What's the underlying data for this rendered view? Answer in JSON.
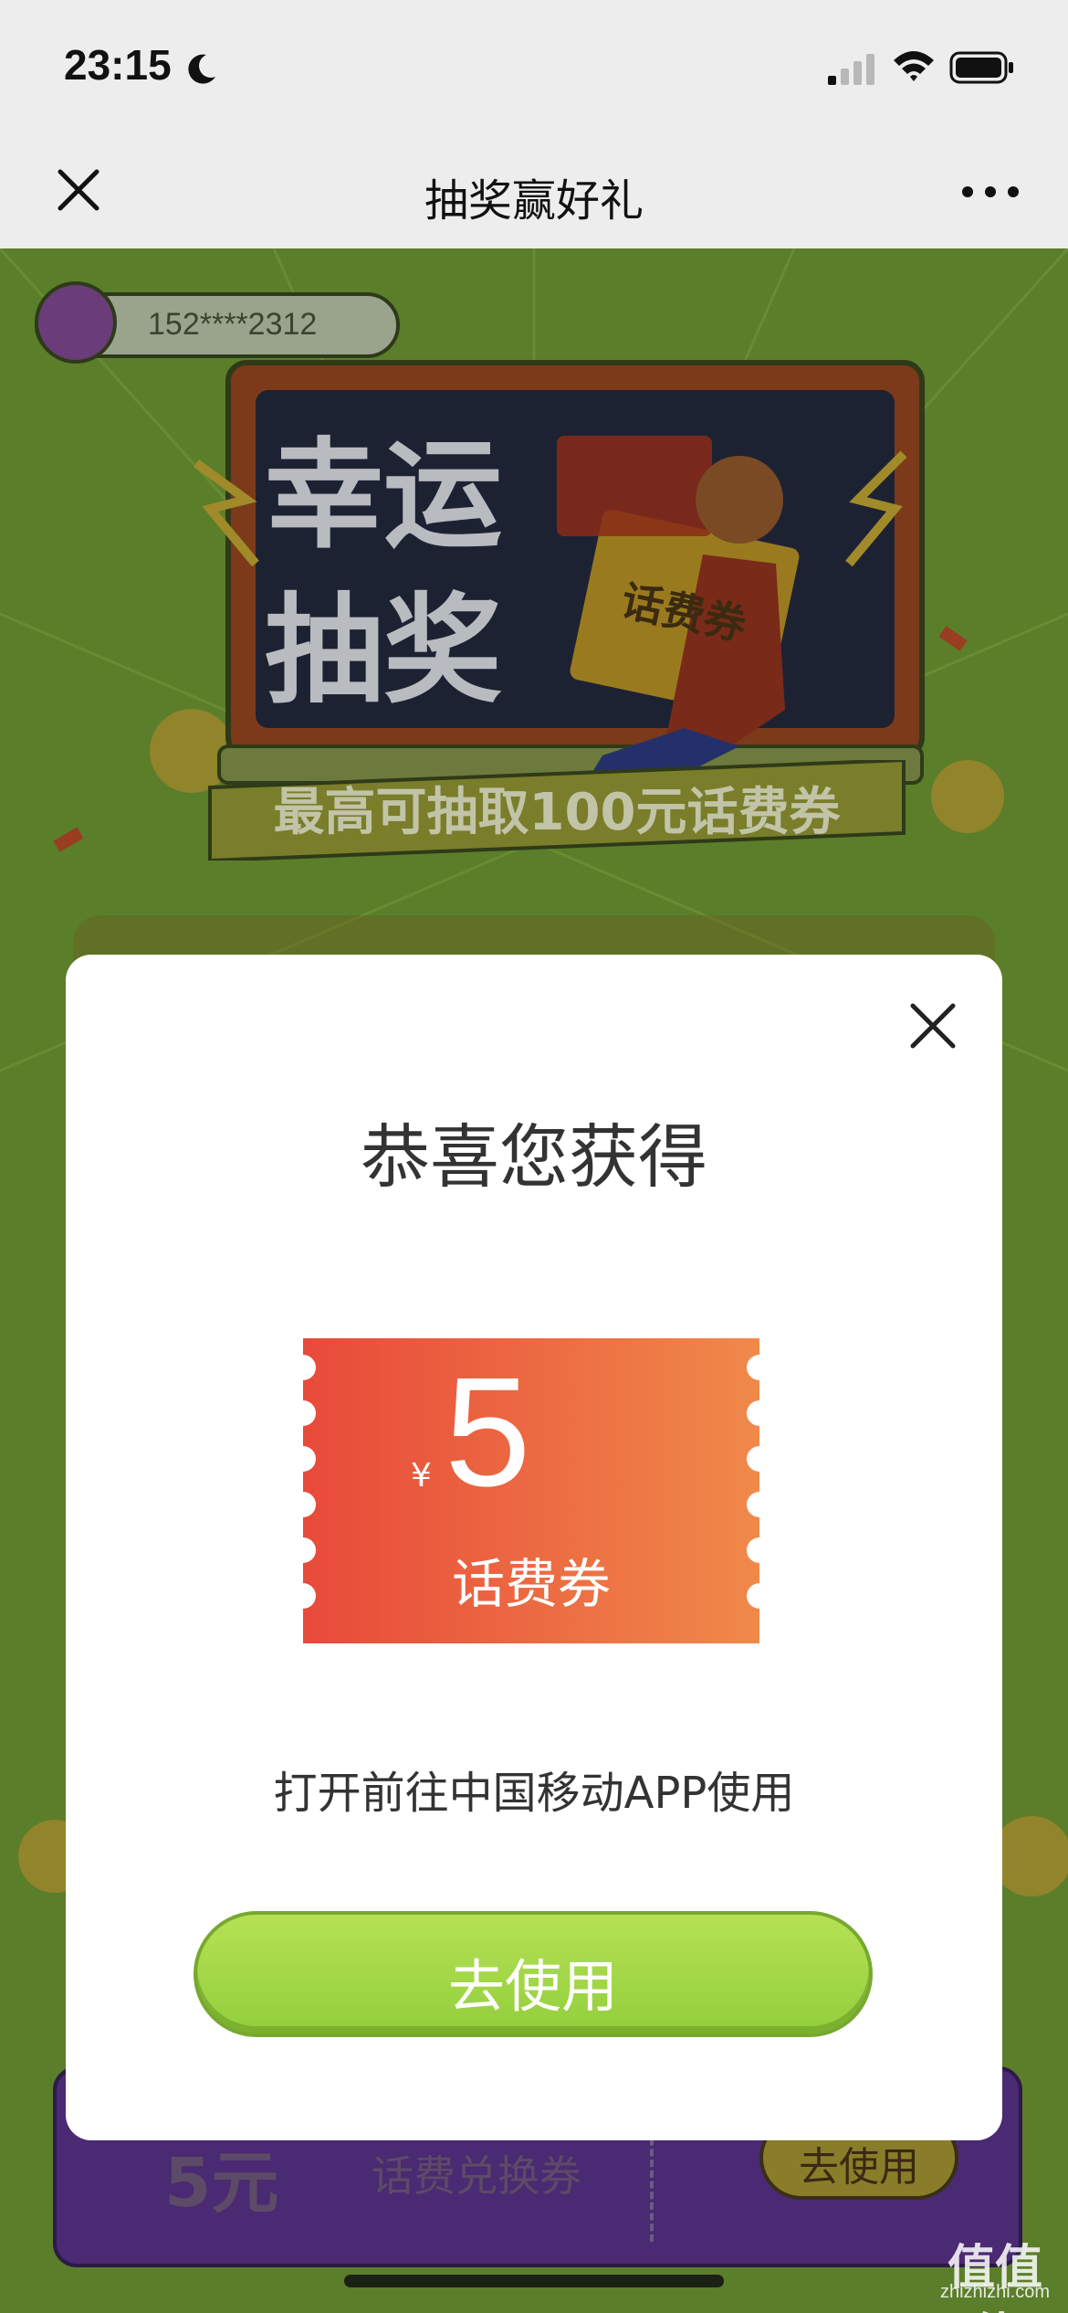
{
  "status_bar": {
    "time": "23:15"
  },
  "nav": {
    "title": "抽奖赢好礼"
  },
  "game": {
    "user_phone": "152****2312",
    "hero_title_line1": "幸运",
    "hero_title_line2": "抽奖",
    "hero_card_label": "话费券",
    "banner": "最高可抽取100元话费券",
    "background_card": {
      "amount": "5元",
      "label": "话费兑换券",
      "button": "去使用"
    }
  },
  "modal": {
    "title": "恭喜您获得",
    "coupon": {
      "currency": "¥",
      "amount": "5",
      "type": "话费券"
    },
    "hint": "打开前往中国移动APP使用",
    "button": "去使用"
  },
  "watermark": {
    "main": "值值值",
    "sub": "zhizhizhi.com"
  },
  "colors": {
    "background_green": "#5b7e2a",
    "coupon_gradient_start": "#e84a3a",
    "coupon_gradient_end": "#f0894a",
    "button_green": "#9fd84a",
    "purple_card": "#4a2a72"
  }
}
